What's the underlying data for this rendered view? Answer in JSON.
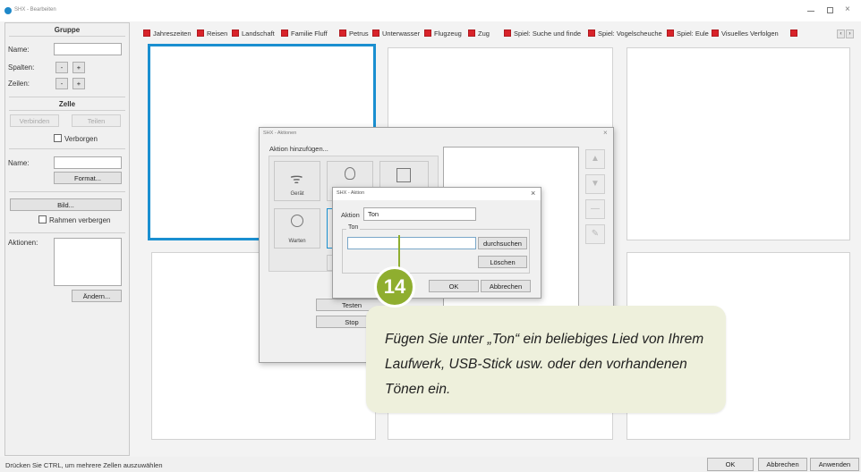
{
  "window": {
    "title": "SHX - Bearbeiten"
  },
  "group": {
    "header": "Gruppe",
    "name_label": "Name:",
    "name_value": "",
    "columns_label": "Spalten:",
    "rows_label": "Zeilen:",
    "minus": "-",
    "plus": "+"
  },
  "cell_panel": {
    "header": "Zelle",
    "connect": "Verbinden",
    "split": "Teilen",
    "hidden_label": "Verborgen",
    "name_label": "Name:",
    "name_value": "",
    "format": "Format...",
    "image": "Bild...",
    "hide_frame": "Rahmen verbergen",
    "actions_label": "Aktionen:",
    "change": "Ändern..."
  },
  "tabs": [
    "Jahreszeiten",
    "Reisen",
    "Landschaft",
    "Familie Fluff",
    "Petrus",
    "Unterwasser",
    "Flugzeug",
    "Zug",
    "Spiel: Suche und finde",
    "Spiel: Vogelscheuche",
    "Spiel: Eule",
    "Visuelles Verfolgen"
  ],
  "actions_dialog": {
    "title": "SHX - Aktionen",
    "add_action": "Aktion hinzufügen...",
    "tiles": [
      "Gerät",
      "",
      "",
      "Warten",
      "",
      ""
    ],
    "test": "Testen",
    "stop": "Stop"
  },
  "action_dialog": {
    "title": "SHX - Aktion",
    "action_label": "Aktion",
    "action_value": "Ton",
    "group_label": "Ton",
    "sound_value": "",
    "browse": "durchsuchen",
    "delete": "Löschen",
    "ok": "OK",
    "cancel": "Abbrechen"
  },
  "callout": {
    "step": "14",
    "text": "Fügen Sie unter „Ton“ ein beliebiges Lied von Ihrem Laufwerk, USB-Stick usw. oder den vorhandenen Tönen ein.",
    "colors": {
      "badge": "#8fae2f",
      "bubble": "#eef0dc"
    }
  },
  "status_bar": {
    "hint": "Drücken Sie CTRL, um mehrere Zellen auszuwählen",
    "ok": "OK",
    "cancel": "Abbrechen",
    "apply": "Anwenden"
  },
  "colors": {
    "selected_cell_border": "#1a8fd0",
    "tab_marker": "#d8232a"
  }
}
